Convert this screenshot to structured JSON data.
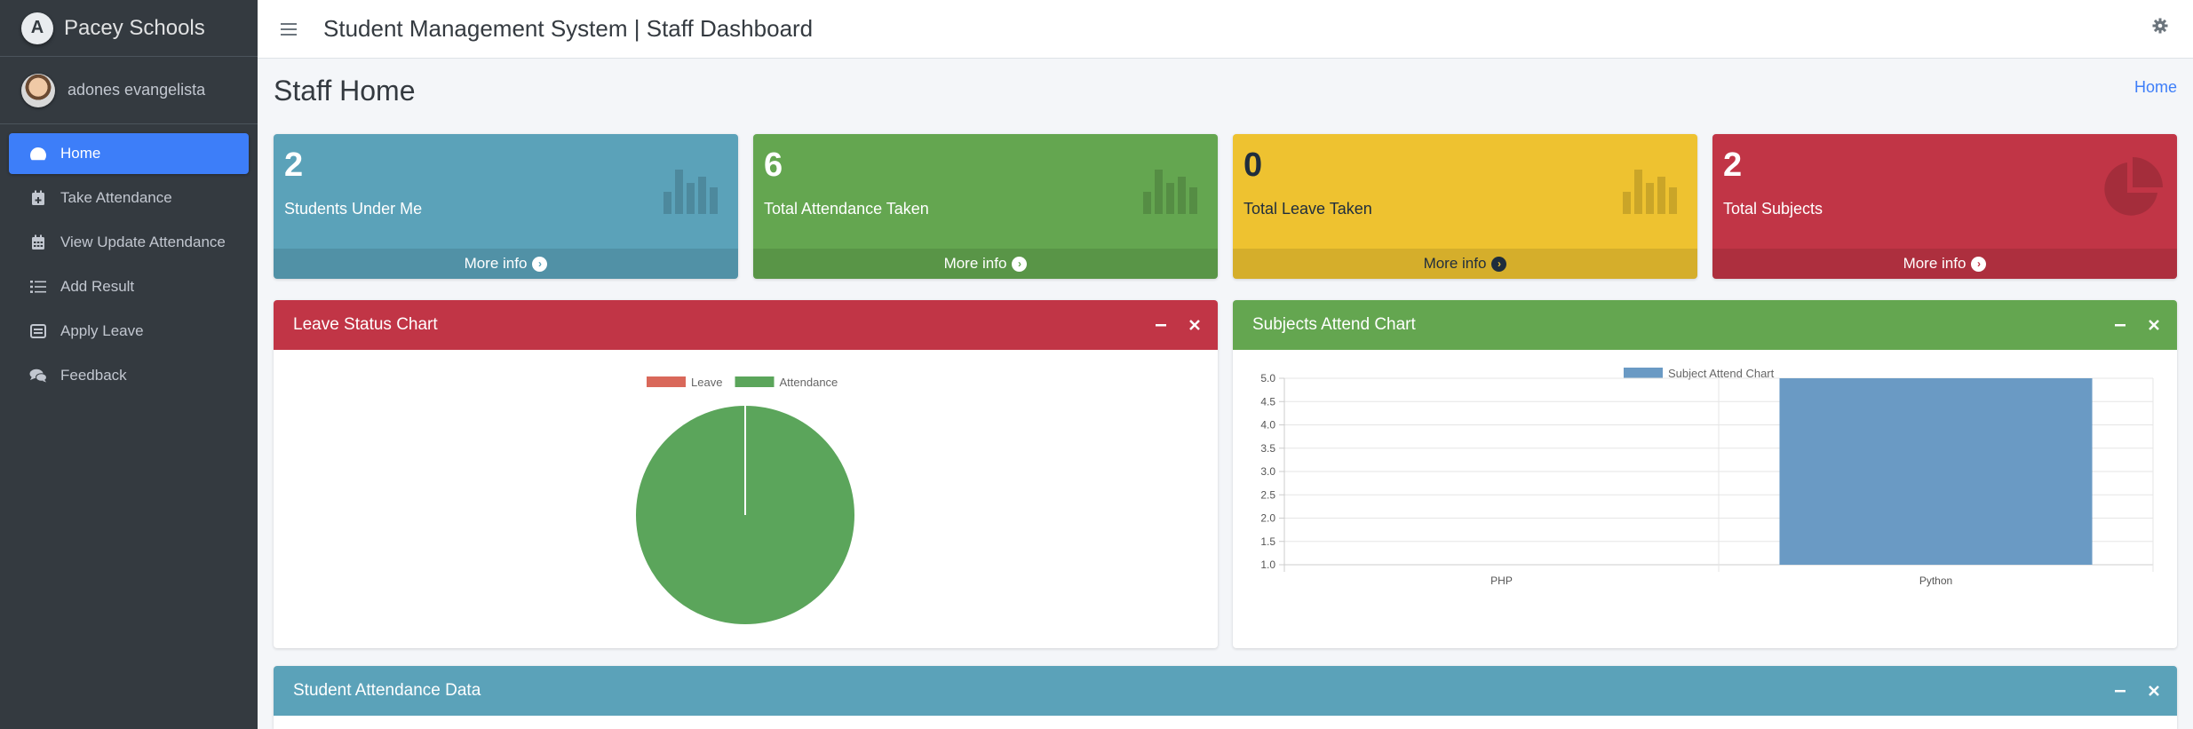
{
  "brand": {
    "logo_letter": "A",
    "name": "Pacey Schools"
  },
  "user": {
    "name": "adones evangelista"
  },
  "sidebar": {
    "items": [
      {
        "label": "Home",
        "icon": "dashboard-icon",
        "active": true
      },
      {
        "label": "Take Attendance",
        "icon": "calendar-plus-icon",
        "active": false
      },
      {
        "label": "View Update Attendance",
        "icon": "calendar-icon",
        "active": false
      },
      {
        "label": "Add Result",
        "icon": "list-icon",
        "active": false
      },
      {
        "label": "Apply Leave",
        "icon": "envelope-icon",
        "active": false
      },
      {
        "label": "Feedback",
        "icon": "comments-icon",
        "active": false
      }
    ]
  },
  "header": {
    "title": "Student Management System | Staff Dashboard"
  },
  "page": {
    "title": "Staff Home",
    "breadcrumb": "Home"
  },
  "stats": [
    {
      "value": "2",
      "label": "Students Under Me",
      "footer": "More info",
      "color": "#5ba2b9",
      "icon": "bar-chart-icon"
    },
    {
      "value": "6",
      "label": "Total Attendance Taken",
      "footer": "More info",
      "color": "#64a650",
      "icon": "bar-chart-icon"
    },
    {
      "value": "0",
      "label": "Total Leave Taken",
      "footer": "More info",
      "color": "#eec230",
      "icon": "bar-chart-icon"
    },
    {
      "value": "2",
      "label": "Total Subjects",
      "footer": "More info",
      "color": "#c13546",
      "icon": "pie-chart-icon"
    }
  ],
  "cards": {
    "leave": {
      "title": "Leave Status Chart",
      "color": "#c13546"
    },
    "subjects": {
      "title": "Subjects Attend Chart",
      "color": "#64a650"
    },
    "attendance": {
      "title": "Student Attendance Data",
      "color": "#5ba2b9"
    }
  },
  "chart_data": [
    {
      "type": "pie",
      "labels": [
        "Leave",
        "Attendance"
      ],
      "values": [
        0,
        6
      ],
      "colors": [
        "#d9685a",
        "#5ba55b"
      ],
      "legend": "top"
    },
    {
      "type": "bar",
      "categories": [
        "PHP",
        "Python"
      ],
      "series": [
        {
          "name": "Subject Attend Chart",
          "values": [
            1.0,
            5.0
          ],
          "color": "#6a9ac4"
        }
      ],
      "ylim": [
        1.0,
        5.0
      ],
      "yticks": [
        "5.0",
        "4.5",
        "4.0",
        "3.5",
        "3.0",
        "2.5",
        "2.0",
        "1.5",
        "1.0"
      ],
      "grid": true,
      "legend": "top"
    }
  ]
}
